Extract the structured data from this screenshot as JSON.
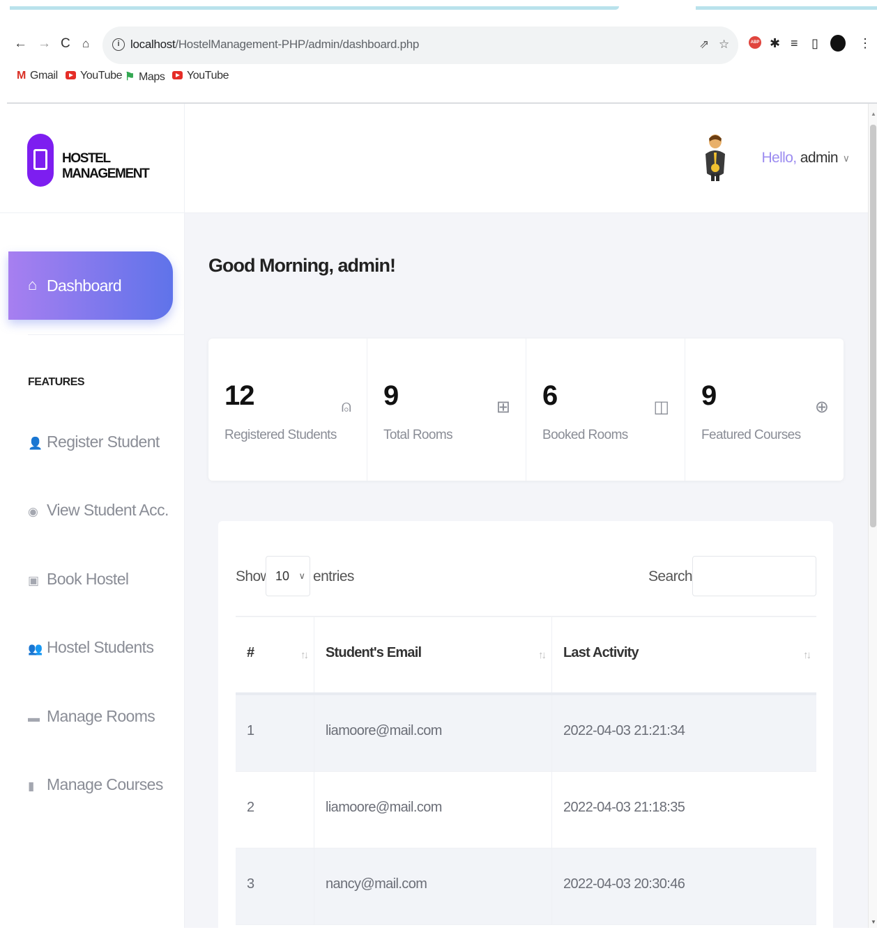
{
  "browser": {
    "url_host": "localhost",
    "url_path": "/HostelManagement-PHP/admin/dashboard.php",
    "bookmarks": [
      "Gmail",
      "YouTube",
      "Maps",
      "YouTube"
    ]
  },
  "sidebar": {
    "brand": "HOSTEL MANAGEMENT",
    "active": "Dashboard",
    "section": "FEATURES",
    "items": [
      {
        "label": "Register Student",
        "icon": "user-plus-icon"
      },
      {
        "label": "View Student Acc.",
        "icon": "user-circle-icon"
      },
      {
        "label": "Book Hostel",
        "icon": "hotel-icon"
      },
      {
        "label": "Hostel Students",
        "icon": "users-icon"
      },
      {
        "label": "Manage Rooms",
        "icon": "bed-icon"
      },
      {
        "label": "Manage Courses",
        "icon": "book-icon"
      }
    ]
  },
  "topbar": {
    "hello": "Hello,",
    "user": "admin"
  },
  "main": {
    "greeting": "Good Morning, admin!",
    "stats": [
      {
        "value": "12",
        "label": "Registered Students",
        "icon": "user-plus-icon"
      },
      {
        "value": "9",
        "label": "Total Rooms",
        "icon": "grid-icon"
      },
      {
        "value": "6",
        "label": "Booked Rooms",
        "icon": "book-open-icon"
      },
      {
        "value": "9",
        "label": "Featured Courses",
        "icon": "globe-icon"
      }
    ],
    "table": {
      "show": "Show",
      "entries_value": "10",
      "entries": "entries",
      "search": "Search:",
      "columns": [
        "#",
        "Student's Email",
        "Last Activity"
      ],
      "rows": [
        [
          "1",
          "liamoore@mail.com",
          "2022-04-03 21:21:34"
        ],
        [
          "2",
          "liamoore@mail.com",
          "2022-04-03 21:18:35"
        ],
        [
          "3",
          "nancy@mail.com",
          "2022-04-03 20:30:46"
        ]
      ]
    }
  },
  "colors": {
    "accent_start": "#a77ff0",
    "accent_end": "#5f73ea",
    "brand": "#7d1ef0"
  }
}
